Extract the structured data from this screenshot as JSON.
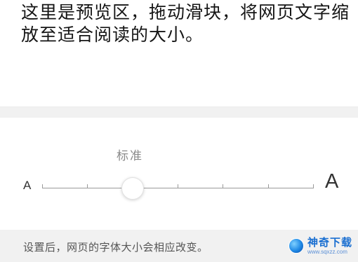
{
  "preview": {
    "text": "这里是预览区，拖动滑块，将网页文字缩放至适合阅读的大小。"
  },
  "slider": {
    "level_label": "标准",
    "min_label": "A",
    "max_label": "A",
    "steps": 7,
    "selected_step": 2
  },
  "footer": {
    "note": "设置后，网页的字体大小会相应改变。"
  },
  "watermark": {
    "title": "神奇下载",
    "url": "www.sqxzz.com"
  },
  "colors": {
    "track": "#9a9a9a",
    "divider_bg": "#f1f1f1",
    "watermark_blue": "#1a6fd1"
  }
}
